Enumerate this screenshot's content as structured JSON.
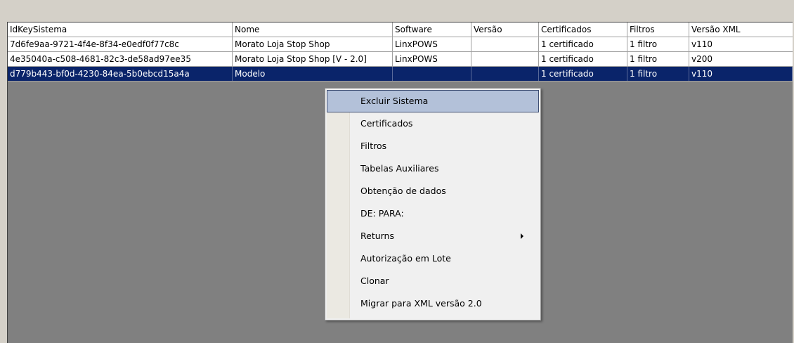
{
  "grid": {
    "columns": [
      "IdKeySistema",
      "Nome",
      "Software",
      "Versão",
      "Certificados",
      "Filtros",
      "Versão XML"
    ],
    "rows": [
      {
        "id": "7d6fe9aa-9721-4f4e-8f34-e0edf0f77c8c",
        "nome": "Morato Loja Stop Shop",
        "software": "LinxPOWS",
        "versao": "",
        "certificados": "1 certificado",
        "filtros": "1 filtro",
        "versao_xml": "v110",
        "selected": false
      },
      {
        "id": "4e35040a-c508-4681-82c3-de58ad97ee35",
        "nome": "Morato Loja Stop Shop [V - 2.0]",
        "software": "LinxPOWS",
        "versao": "",
        "certificados": "1 certificado",
        "filtros": "1 filtro",
        "versao_xml": "v200",
        "selected": false
      },
      {
        "id": "d779b443-bf0d-4230-84ea-5b0ebcd15a4a",
        "nome": "Modelo",
        "software": "",
        "versao": "",
        "certificados": "1 certificado",
        "filtros": "1 filtro",
        "versao_xml": "v110",
        "selected": true
      }
    ]
  },
  "context_menu": {
    "items": [
      {
        "label": "Excluir Sistema",
        "hover": true,
        "submenu": false
      },
      {
        "label": "Certificados",
        "hover": false,
        "submenu": false
      },
      {
        "label": "Filtros",
        "hover": false,
        "submenu": false
      },
      {
        "label": "Tabelas Auxiliares",
        "hover": false,
        "submenu": false
      },
      {
        "label": "Obtenção de dados",
        "hover": false,
        "submenu": false
      },
      {
        "label": "DE: PARA:",
        "hover": false,
        "submenu": false
      },
      {
        "label": "Returns",
        "hover": false,
        "submenu": true
      },
      {
        "label": "Autorização em Lote",
        "hover": false,
        "submenu": false
      },
      {
        "label": "Clonar",
        "hover": false,
        "submenu": false
      },
      {
        "label": "Migrar para XML versão 2.0",
        "hover": false,
        "submenu": false
      }
    ]
  },
  "colors": {
    "selection": "#0a246a",
    "menu_hover": "#b3c1d9",
    "grid_background": "#808080"
  }
}
